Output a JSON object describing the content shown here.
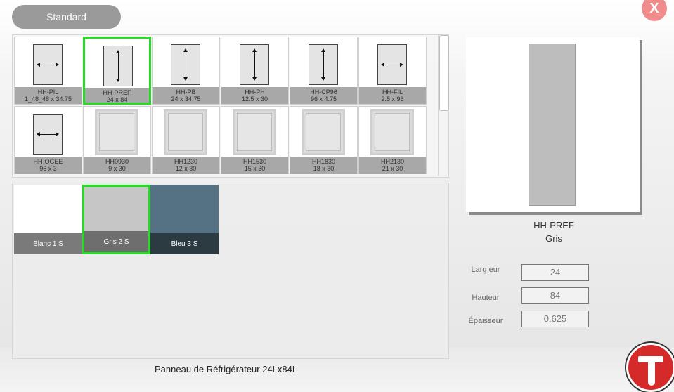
{
  "header": {
    "standard_button": "Standard",
    "close_label": "X"
  },
  "products": [
    {
      "name": "HH-PIL",
      "dims": "1_48_48 x 34.75",
      "thumb": "panel",
      "arrow": "horizontal",
      "selected": false
    },
    {
      "name": "HH-PREF",
      "dims": "24 x 84",
      "thumb": "panel",
      "arrow": "vertical",
      "selected": true
    },
    {
      "name": "HH-PB",
      "dims": "24 x 34.75",
      "thumb": "panel",
      "arrow": "vertical",
      "selected": false
    },
    {
      "name": "HH-PH",
      "dims": "12.5 x 30",
      "thumb": "panel",
      "arrow": "vertical",
      "selected": false
    },
    {
      "name": "HH-CP96",
      "dims": "96 x 4.75",
      "thumb": "panel",
      "arrow": "vertical",
      "selected": false
    },
    {
      "name": "HH-FIL",
      "dims": "2.5 x 96",
      "thumb": "panel",
      "arrow": "horizontal",
      "selected": false
    },
    {
      "name": "HH-OGEE",
      "dims": "96 x 3",
      "thumb": "panel",
      "arrow": "horizontal",
      "selected": false
    },
    {
      "name": "HH0930",
      "dims": "9 x 30",
      "thumb": "door",
      "selected": false
    },
    {
      "name": "HH1230",
      "dims": "12 x 30",
      "thumb": "door",
      "selected": false
    },
    {
      "name": "HH1530",
      "dims": "15 x 30",
      "thumb": "door",
      "selected": false
    },
    {
      "name": "HH1830",
      "dims": "18 x 30",
      "thumb": "door",
      "selected": false
    },
    {
      "name": "HH2130",
      "dims": "21 x 30",
      "thumb": "door",
      "selected": false
    }
  ],
  "colors": [
    {
      "label": "Blanc 1 S",
      "swatch": "#ffffff",
      "bar": "#7a7a7a",
      "selected": false
    },
    {
      "label": "Gris 2 S",
      "swatch": "#c6c6c6",
      "bar": "#6e6e6e",
      "selected": true
    },
    {
      "label": "Bleu 3 S",
      "swatch": "#557285",
      "bar": "#2c3a42",
      "selected": false
    }
  ],
  "selection": {
    "name": "HH-PREF",
    "color": "Gris"
  },
  "dimensions": {
    "width_label": "Larg eur",
    "width_value": "24",
    "height_label": "Hauteur",
    "height_value": "84",
    "thickness_label": "Épaisseur",
    "thickness_value": "0.625"
  },
  "caption": "Panneau de Réfrigérateur 24Lx84L",
  "theme": {
    "selection_color": "#22dd22",
    "close_color": "#f08c8c",
    "logo_color": "#d42a2a"
  }
}
